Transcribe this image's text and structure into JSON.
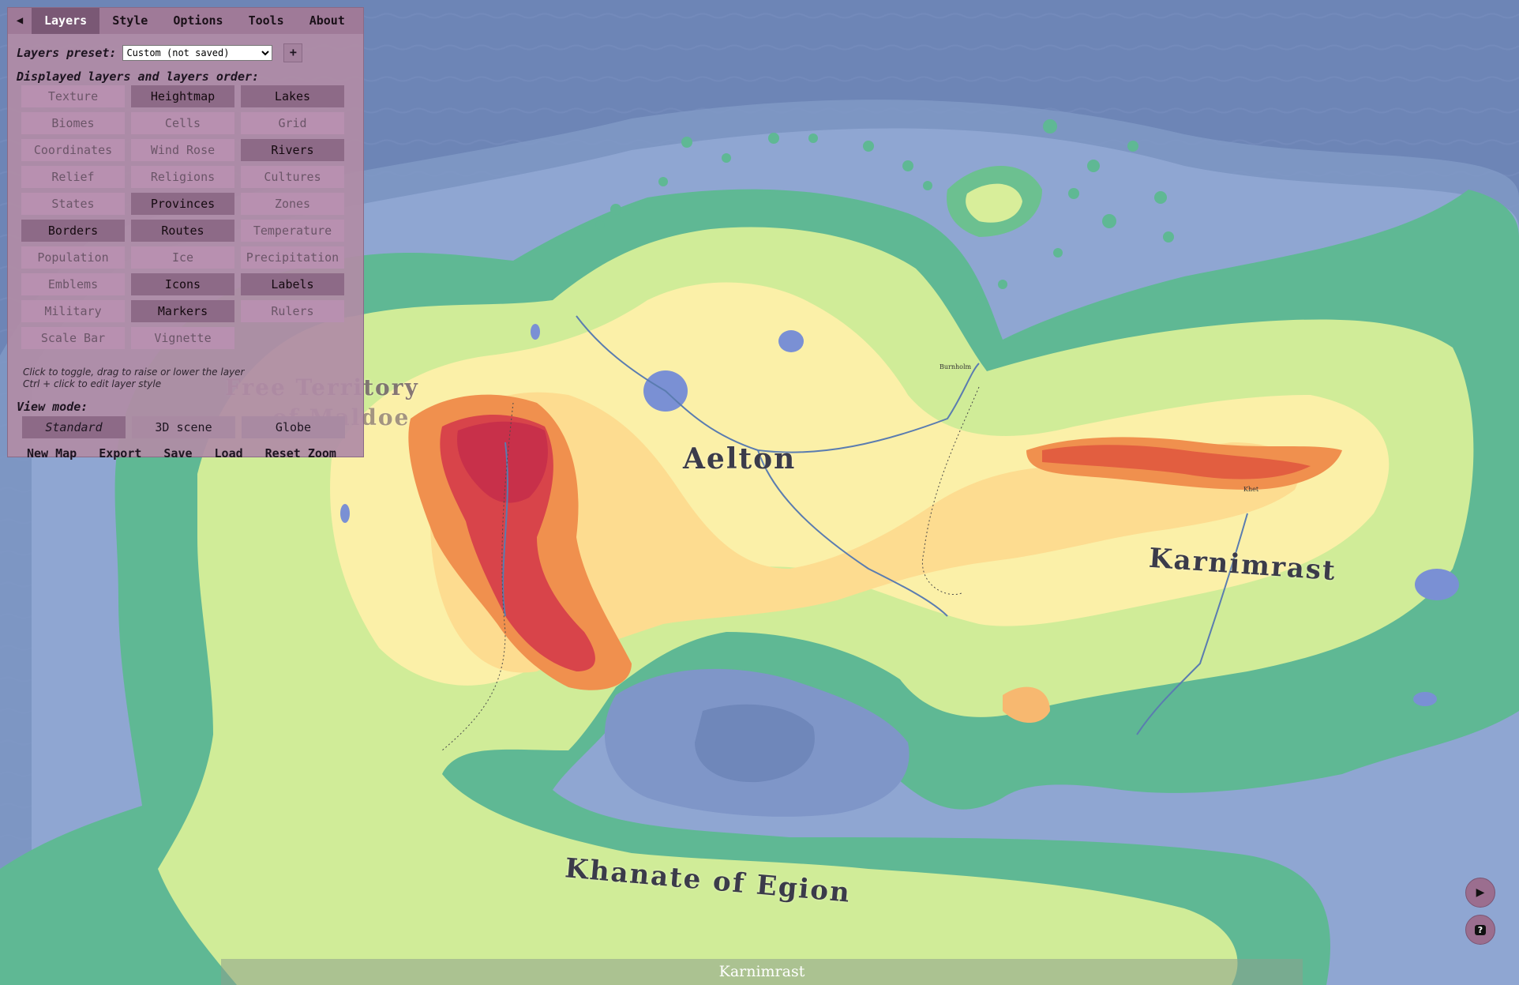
{
  "panel": {
    "collapse_icon": "◀",
    "tabs": [
      "Layers",
      "Style",
      "Options",
      "Tools",
      "About"
    ],
    "active_tab": "Layers",
    "preset_label": "Layers preset:",
    "preset_value": "Custom (not saved)",
    "preset_add_label": "+",
    "layers_title": "Displayed layers and layers order:",
    "layers": [
      {
        "label": "Texture",
        "on": false
      },
      {
        "label": "Heightmap",
        "on": true
      },
      {
        "label": "Lakes",
        "on": true
      },
      {
        "label": "Biomes",
        "on": false
      },
      {
        "label": "Cells",
        "on": false
      },
      {
        "label": "Grid",
        "on": false
      },
      {
        "label": "Coordinates",
        "on": false
      },
      {
        "label": "Wind Rose",
        "on": false
      },
      {
        "label": "Rivers",
        "on": true
      },
      {
        "label": "Relief",
        "on": false
      },
      {
        "label": "Religions",
        "on": false
      },
      {
        "label": "Cultures",
        "on": false
      },
      {
        "label": "States",
        "on": false
      },
      {
        "label": "Provinces",
        "on": true
      },
      {
        "label": "Zones",
        "on": false
      },
      {
        "label": "Borders",
        "on": true
      },
      {
        "label": "Routes",
        "on": true
      },
      {
        "label": "Temperature",
        "on": false
      },
      {
        "label": "Population",
        "on": false
      },
      {
        "label": "Ice",
        "on": false
      },
      {
        "label": "Precipitation",
        "on": false
      },
      {
        "label": "Emblems",
        "on": false
      },
      {
        "label": "Icons",
        "on": true
      },
      {
        "label": "Labels",
        "on": true
      },
      {
        "label": "Military",
        "on": false
      },
      {
        "label": "Markers",
        "on": true
      },
      {
        "label": "Rulers",
        "on": false
      },
      {
        "label": "Scale Bar",
        "on": false
      },
      {
        "label": "Vignette",
        "on": false
      }
    ],
    "hint_line1": "Click to toggle, drag to raise or lower the layer",
    "hint_line2": "Ctrl + click to edit layer style",
    "view_title": "View mode:",
    "view_modes": [
      {
        "label": "Standard",
        "on": true
      },
      {
        "label": "3D scene",
        "on": false
      },
      {
        "label": "Globe",
        "on": false
      }
    ],
    "actions": [
      "New Map",
      "Export",
      "Save",
      "Load",
      "Reset Zoom"
    ]
  },
  "map": {
    "labels": {
      "free_territory": "Free Territory",
      "free_territory_2": "of Maldoe",
      "aelton": "Aelton",
      "karnimrast": "Karnimrast",
      "khanate": "Khanate of Egion"
    },
    "burgs": {
      "burg_1": "Burnholm",
      "burg_2": "Khet"
    },
    "colors": {
      "ocean_deep": "#6a82b4",
      "ocean_shallow": "#8aa0cc",
      "lowland": "#5fb894",
      "midland": "#d4ee9a",
      "highland": "#fde7a0",
      "mountain": "#e8603e",
      "peak": "#c8304a"
    }
  },
  "status_bar": {
    "text": "Karnimrast"
  },
  "buttons": {
    "play_icon": "▶",
    "help_icon": "?"
  }
}
